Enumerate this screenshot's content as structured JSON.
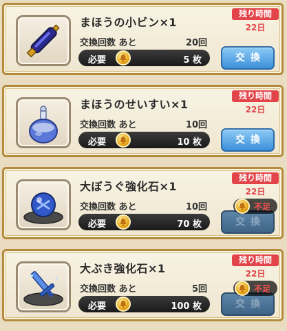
{
  "colors": {
    "card_border": "#b48a3c",
    "time_badge": "#e24449",
    "shortage_text": "#ff5050",
    "exchange_button": "#3c90da"
  },
  "items": [
    {
      "name": "まほうの小ビン×1",
      "icon": "magic-bottle-icon",
      "count_label": "交換回数 あと",
      "count_value": "20回",
      "cost_label": "必要",
      "cost_value": "5 枚",
      "time_label": "残り時間",
      "time_value": "22日",
      "button_label": "交換",
      "enabled": true
    },
    {
      "name": "まほうのせいすい×1",
      "icon": "holy-water-icon",
      "count_label": "交換回数 あと",
      "count_value": "10回",
      "cost_label": "必要",
      "cost_value": "10 枚",
      "time_label": "残り時間",
      "time_value": "22日",
      "button_label": "交換",
      "enabled": true
    },
    {
      "name": "大ぼうぐ強化石×1",
      "icon": "armor-stone-icon",
      "count_label": "交換回数 あと",
      "count_value": "10回",
      "cost_label": "必要",
      "cost_value": "70 枚",
      "time_label": "残り時間",
      "time_value": "22日",
      "button_label": "交換",
      "enabled": false,
      "shortage_label": "不足"
    },
    {
      "name": "大ぶき強化石×1",
      "icon": "weapon-stone-icon",
      "count_label": "交換回数 あと",
      "count_value": "5回",
      "cost_label": "必要",
      "cost_value": "100 枚",
      "time_label": "残り時間",
      "time_value": "22日",
      "button_label": "交換",
      "enabled": false,
      "shortage_label": "不足"
    }
  ]
}
